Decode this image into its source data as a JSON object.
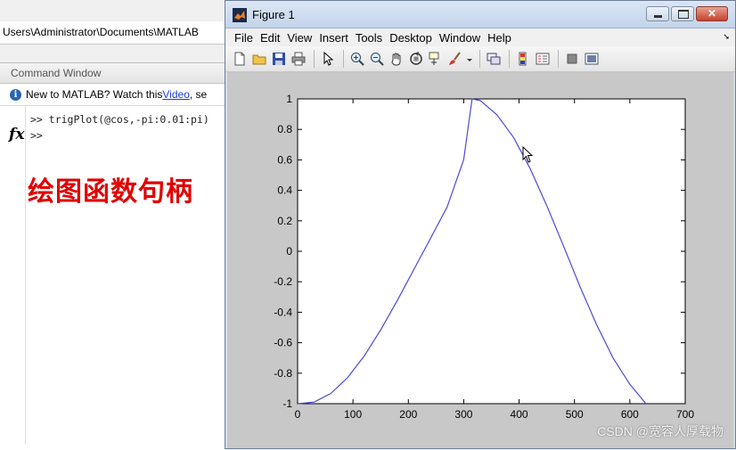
{
  "matlab": {
    "current_path": "Users\\Administrator\\Documents\\MATLAB",
    "command_window": {
      "title": "Command Window",
      "info_text_before": "New to MATLAB? Watch this ",
      "info_link": "Video",
      "info_text_after": ", se",
      "history_line": ">> trigPlot(@cos,-pi:0.01:pi)",
      "prompt": ">>"
    },
    "overlay_title": "绘图函数句柄"
  },
  "figure": {
    "title": "Figure 1",
    "close_symbol": "✕",
    "menu": [
      "File",
      "Edit",
      "View",
      "Insert",
      "Tools",
      "Desktop",
      "Window",
      "Help"
    ],
    "toolbar_icons": [
      "new-figure-icon",
      "open-file-icon",
      "save-icon",
      "print-icon",
      "separator",
      "edit-plot-arrow-icon",
      "separator",
      "zoom-in-icon",
      "zoom-out-icon",
      "pan-hand-icon",
      "rotate-3d-icon",
      "data-cursor-icon",
      "brush-icon",
      "brush-dropdown-icon",
      "separator",
      "link-plot-icon",
      "separator",
      "colorbar-icon",
      "legend-icon",
      "separator",
      "hide-plot-tools-icon",
      "show-plot-tools-icon"
    ]
  },
  "chart_data": {
    "type": "line",
    "title": "",
    "xlabel": "",
    "ylabel": "",
    "xlim": [
      0,
      700
    ],
    "ylim": [
      -1,
      1
    ],
    "xticks": [
      0,
      100,
      200,
      300,
      400,
      500,
      600,
      700
    ],
    "yticks": [
      -1,
      -0.8,
      -0.6,
      -0.4,
      -0.2,
      0,
      0.2,
      0.4,
      0.6,
      0.8,
      1
    ],
    "ytick_labels": [
      "-1",
      "-0.8",
      "-0.6",
      "-0.4",
      "-0.2",
      "0",
      "0.2",
      "0.4",
      "0.6",
      "0.8",
      "1"
    ],
    "grid": false,
    "series": [
      {
        "color": "#4a4ad8",
        "x": [
          1,
          30,
          60,
          90,
          120,
          150,
          180,
          210,
          240,
          270,
          300,
          315,
          330,
          360,
          390,
          420,
          450,
          480,
          510,
          540,
          570,
          600,
          629
        ],
        "y": [
          -1.0,
          -0.9894,
          -0.9327,
          -0.8304,
          -0.6888,
          -0.5161,
          -0.3227,
          -0.1191,
          0.0843,
          0.2905,
          0.6014,
          0.9999,
          0.9886,
          0.8957,
          0.7465,
          0.5428,
          0.2998,
          0.0362,
          -0.2315,
          -0.4823,
          -0.7021,
          -0.8732,
          -1.0
        ]
      }
    ]
  },
  "watermark": "CSDN @宽容人厚载物"
}
